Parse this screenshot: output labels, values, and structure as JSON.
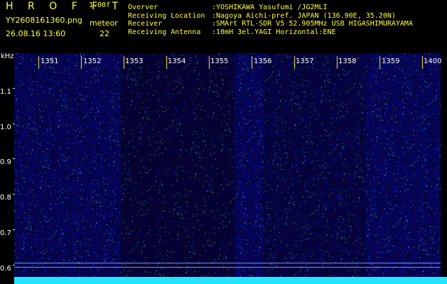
{
  "header": {
    "title": "H R O F F T",
    "version": "1.00f",
    "filename": "YY2608161360.png",
    "label_meteor": "meteor",
    "datetime": "26.08.16 13:60",
    "meteor_count": "22",
    "info": [
      {
        "label": "Overver",
        "value": ":YOSHIKAWA Yasufumi /JG2MLI"
      },
      {
        "label": "Receiving Location",
        "value": ":Nagoya Aichi-pref. JAPAN (136.90E, 35.20N)"
      },
      {
        "label": "Receiver",
        "value": ":SMArt RTL-SDR V5 52.905MHz USB HIGASHIMURAYAMA"
      },
      {
        "label": "Receiving Antenna",
        "value": ":10mH 3el.YAGI Horizontal:ENE"
      }
    ]
  },
  "plot": {
    "y_unit": "kHz",
    "y_ticks": [
      "1.1",
      "1.0",
      "0.9",
      "0.8",
      "0.7",
      "0.6"
    ],
    "x_ticks": [
      "1351",
      "1352",
      "1353",
      "1354",
      "1355",
      "1356",
      "1357",
      "1358",
      "1359",
      "1400"
    ],
    "colors": {
      "bg": "#0b0f4a",
      "bright": "#1f3fd6",
      "base": "#22e6ff"
    }
  }
}
